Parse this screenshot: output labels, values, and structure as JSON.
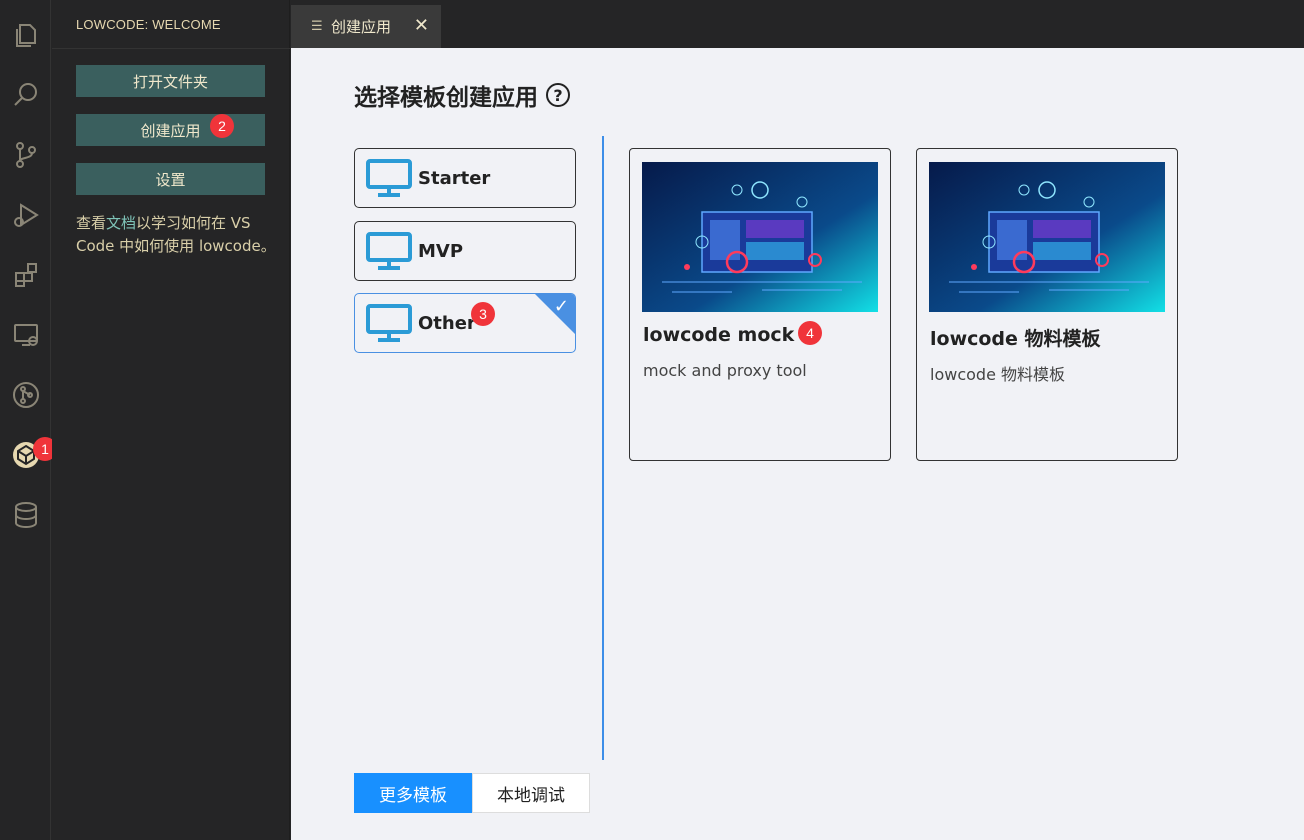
{
  "sidebar": {
    "title": "LOWCODE: WELCOME",
    "buttons": {
      "open_folder": "打开文件夹",
      "create_app": "创建应用",
      "settings": "设置"
    },
    "help_text": {
      "prefix": "查看",
      "link": "文档",
      "suffix": "以学习如何在 VS Code 中如何使用 lowcode。"
    }
  },
  "badges": {
    "b1": "1",
    "b2": "2",
    "b3": "3",
    "b4": "4"
  },
  "tab": {
    "label": "创建应用",
    "close": "✕"
  },
  "main": {
    "title": "选择模板创建应用",
    "help_icon": "?",
    "categories": [
      {
        "label": "Starter"
      },
      {
        "label": "MVP"
      },
      {
        "label": "Other",
        "selected": true
      }
    ],
    "cards": [
      {
        "title": "lowcode mock",
        "description": "mock and proxy tool"
      },
      {
        "title": "lowcode 物料模板",
        "description": "lowcode 物料模板"
      }
    ],
    "bottom_buttons": {
      "more_templates": "更多模板",
      "local_debug": "本地调试"
    }
  },
  "colors": {
    "accent": "#1890ff",
    "sidebar_button": "#3a5f5e",
    "badge": "#f0343a",
    "divider": "#3d8ee8",
    "monitor": "#2b9bd6"
  }
}
